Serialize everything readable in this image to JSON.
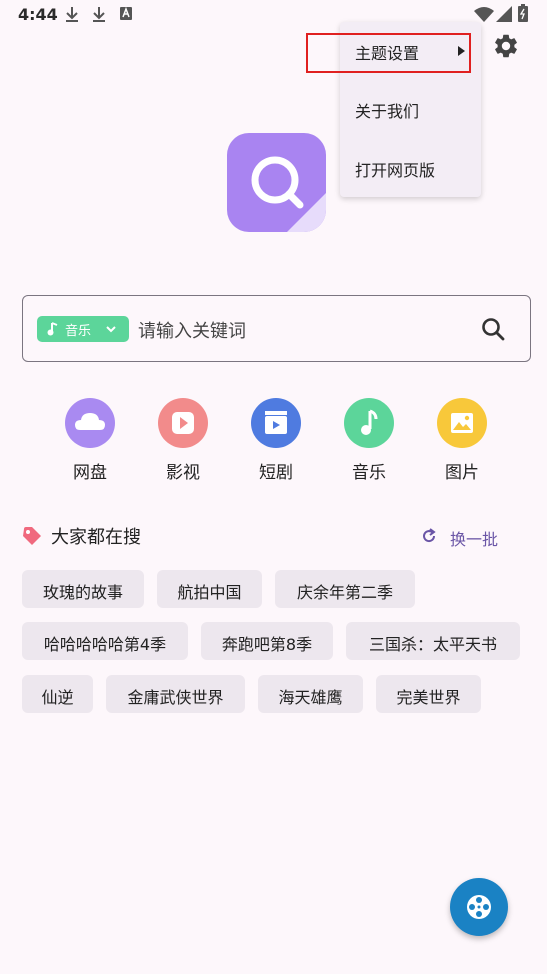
{
  "status_bar": {
    "time": "4:44",
    "icons": [
      "download-icon",
      "download-icon",
      "app-notification-icon",
      "wifi-icon",
      "signal-icon",
      "battery-icon"
    ]
  },
  "menu": {
    "items": [
      {
        "label": "主题设置",
        "has_submenu": true
      },
      {
        "label": "关于我们"
      },
      {
        "label": "打开网页版"
      }
    ]
  },
  "search": {
    "category_chip": "音乐",
    "placeholder": "请输入关键词"
  },
  "categories": [
    {
      "label": "网盘",
      "icon": "cloud-icon",
      "color": "#a98af1"
    },
    {
      "label": "影视",
      "icon": "play-icon",
      "color": "#f28b8b"
    },
    {
      "label": "短剧",
      "icon": "clapper-icon",
      "color": "#4f7be0"
    },
    {
      "label": "音乐",
      "icon": "music-note-icon",
      "color": "#5cd59a"
    },
    {
      "label": "图片",
      "icon": "image-icon",
      "color": "#f8c83a"
    }
  ],
  "trending": {
    "title": "大家都在搜",
    "refresh_label": "换一批",
    "tags": [
      "玫瑰的故事",
      "航拍中国",
      "庆余年第二季",
      "哈哈哈哈哈第4季",
      "奔跑吧第8季",
      "三国杀：太平天书",
      "仙逆",
      "金庸武侠世界",
      "海天雄鹰",
      "完美世界"
    ]
  },
  "colors": {
    "background": "#fdf7fb",
    "accent": "#6a55a6",
    "fab": "#1a82c4",
    "highlight": "#e02020"
  }
}
